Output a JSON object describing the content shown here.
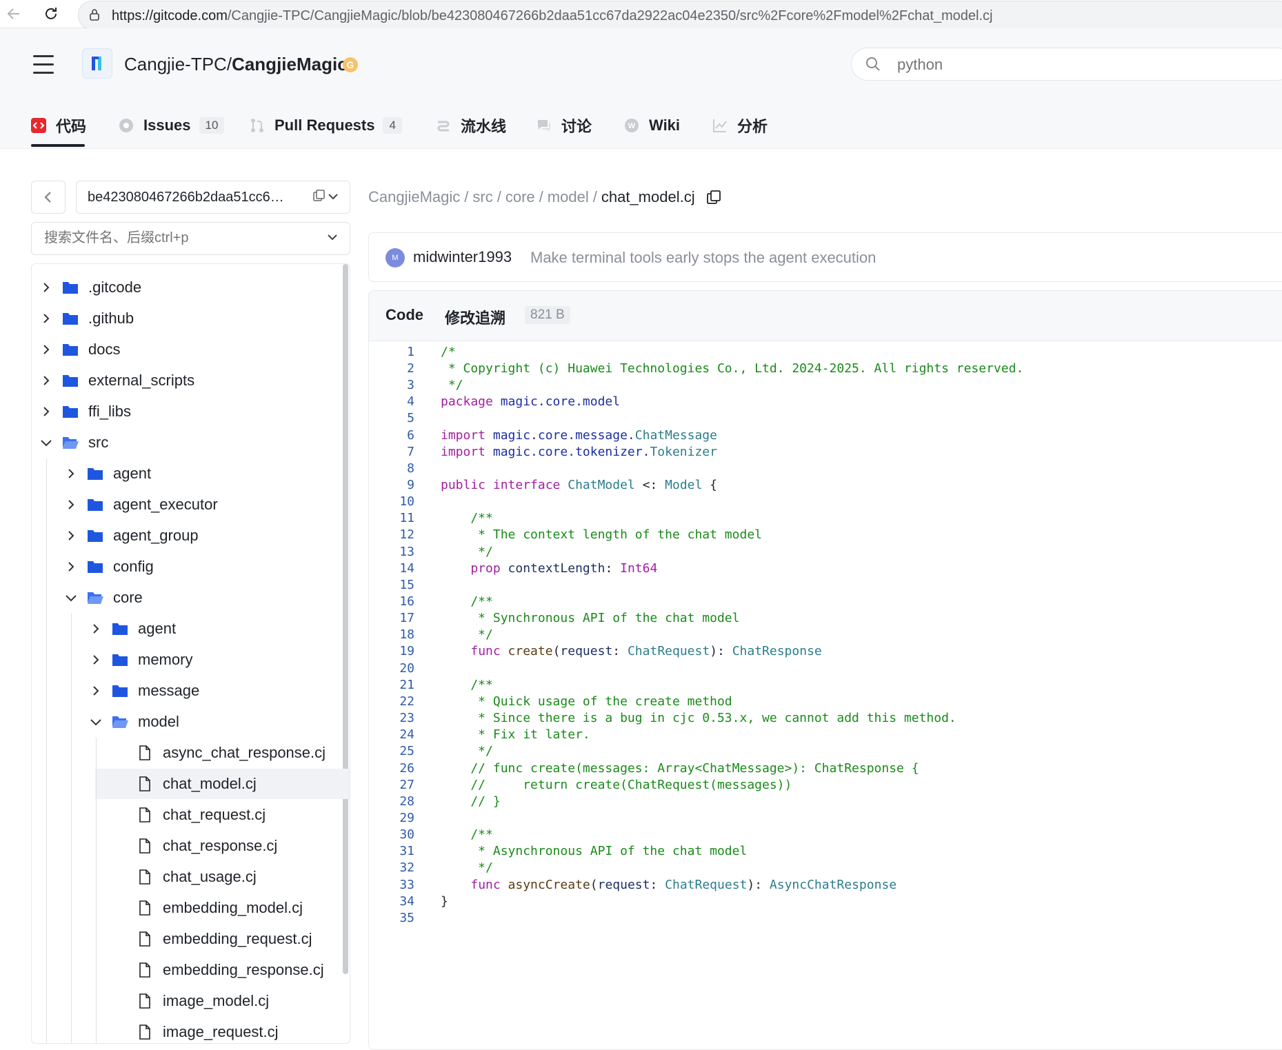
{
  "browser": {
    "url_host": "https://gitcode.com",
    "url_path": "/Cangjie-TPC/CangjieMagic/blob/be423080467266b2daa51cc67da2922ac04e2350/src%2Fcore%2Fmodel%2Fchat_model.cj"
  },
  "header": {
    "owner": "Cangjie-TPC/",
    "repo": "CangjieMagic",
    "badge": "G",
    "search_placeholder": "python"
  },
  "tabs": [
    {
      "label": "代码"
    },
    {
      "label": "Issues",
      "count": "10"
    },
    {
      "label": "Pull Requests",
      "count": "4"
    },
    {
      "label": "流水线"
    },
    {
      "label": "讨论"
    },
    {
      "label": "Wiki"
    },
    {
      "label": "分析"
    }
  ],
  "sidebar": {
    "branch": "be423080467266b2daa51cc6…",
    "file_search_placeholder": "搜索文件名、后缀ctrl+p",
    "tree": [
      {
        "name": ".gitcode",
        "type": "folder",
        "depth": 0,
        "expanded": false
      },
      {
        "name": ".github",
        "type": "folder",
        "depth": 0,
        "expanded": false
      },
      {
        "name": "docs",
        "type": "folder",
        "depth": 0,
        "expanded": false
      },
      {
        "name": "external_scripts",
        "type": "folder",
        "depth": 0,
        "expanded": false
      },
      {
        "name": "ffi_libs",
        "type": "folder",
        "depth": 0,
        "expanded": false
      },
      {
        "name": "src",
        "type": "folder",
        "depth": 0,
        "expanded": true
      },
      {
        "name": "agent",
        "type": "folder",
        "depth": 1,
        "expanded": false
      },
      {
        "name": "agent_executor",
        "type": "folder",
        "depth": 1,
        "expanded": false
      },
      {
        "name": "agent_group",
        "type": "folder",
        "depth": 1,
        "expanded": false
      },
      {
        "name": "config",
        "type": "folder",
        "depth": 1,
        "expanded": false
      },
      {
        "name": "core",
        "type": "folder",
        "depth": 1,
        "expanded": true
      },
      {
        "name": "agent",
        "type": "folder",
        "depth": 2,
        "expanded": false
      },
      {
        "name": "memory",
        "type": "folder",
        "depth": 2,
        "expanded": false
      },
      {
        "name": "message",
        "type": "folder",
        "depth": 2,
        "expanded": false
      },
      {
        "name": "model",
        "type": "folder",
        "depth": 2,
        "expanded": true
      },
      {
        "name": "async_chat_response.cj",
        "type": "file",
        "depth": 3
      },
      {
        "name": "chat_model.cj",
        "type": "file",
        "depth": 3,
        "selected": true
      },
      {
        "name": "chat_request.cj",
        "type": "file",
        "depth": 3
      },
      {
        "name": "chat_response.cj",
        "type": "file",
        "depth": 3
      },
      {
        "name": "chat_usage.cj",
        "type": "file",
        "depth": 3
      },
      {
        "name": "embedding_model.cj",
        "type": "file",
        "depth": 3
      },
      {
        "name": "embedding_request.cj",
        "type": "file",
        "depth": 3
      },
      {
        "name": "embedding_response.cj",
        "type": "file",
        "depth": 3
      },
      {
        "name": "image_model.cj",
        "type": "file",
        "depth": 3
      },
      {
        "name": "image_request.cj",
        "type": "file",
        "depth": 3
      }
    ]
  },
  "breadcrumb": [
    "CangjieMagic",
    "src",
    "core",
    "model",
    "chat_model.cj"
  ],
  "commit": {
    "avatar": "M",
    "author": "midwinter1993",
    "message": "Make terminal tools early stops the agent execution"
  },
  "code_panel": {
    "tab_code": "Code",
    "tab_blame": "修改追溯",
    "size": "821 B"
  },
  "colors": {
    "comment": "#1a8a1a",
    "keyword": "#a020a0",
    "type": "#2c7c8c",
    "folder": "#1f56e0",
    "accent_red": "#e4292f"
  },
  "code": [
    [
      [
        "c",
        "/*"
      ]
    ],
    [
      [
        "c",
        " * Copyright (c) Huawei Technologies Co., Ltd. 2024-2025. All rights reserved."
      ]
    ],
    [
      [
        "c",
        " */"
      ]
    ],
    [
      [
        "k",
        "package "
      ],
      [
        "n",
        "magic.core.model"
      ]
    ],
    [],
    [
      [
        "k",
        "import "
      ],
      [
        "n",
        "magic.core.message."
      ],
      [
        "t",
        "ChatMessage"
      ]
    ],
    [
      [
        "k",
        "import "
      ],
      [
        "n",
        "magic.core.tokenizer."
      ],
      [
        "t",
        "Tokenizer"
      ]
    ],
    [],
    [
      [
        "k",
        "public interface "
      ],
      [
        "t",
        "ChatModel"
      ],
      [
        "p",
        " <: "
      ],
      [
        "t",
        "Model"
      ],
      [
        "p",
        " {"
      ]
    ],
    [],
    [
      [
        "c",
        "    /**"
      ]
    ],
    [
      [
        "c",
        "     * The context length of the chat model"
      ]
    ],
    [
      [
        "c",
        "     */"
      ]
    ],
    [
      [
        "p",
        "    "
      ],
      [
        "k",
        "prop "
      ],
      [
        "a",
        "contextLength"
      ],
      [
        "p",
        ": "
      ],
      [
        "k",
        "Int64"
      ]
    ],
    [],
    [
      [
        "c",
        "    /**"
      ]
    ],
    [
      [
        "c",
        "     * Synchronous API of the chat model"
      ]
    ],
    [
      [
        "c",
        "     */"
      ]
    ],
    [
      [
        "p",
        "    "
      ],
      [
        "k",
        "func "
      ],
      [
        "f",
        "create"
      ],
      [
        "p",
        "("
      ],
      [
        "a",
        "request"
      ],
      [
        "p",
        ": "
      ],
      [
        "t",
        "ChatRequest"
      ],
      [
        "p",
        "): "
      ],
      [
        "t",
        "ChatResponse"
      ]
    ],
    [],
    [
      [
        "c",
        "    /**"
      ]
    ],
    [
      [
        "c",
        "     * Quick usage of the create method"
      ]
    ],
    [
      [
        "c",
        "     * Since there is a bug in cjc 0.53.x, we cannot add this method."
      ]
    ],
    [
      [
        "c",
        "     * Fix it later."
      ]
    ],
    [
      [
        "c",
        "     */"
      ]
    ],
    [
      [
        "c",
        "    // func create(messages: Array<ChatMessage>): ChatResponse {"
      ]
    ],
    [
      [
        "c",
        "    //     return create(ChatRequest(messages))"
      ]
    ],
    [
      [
        "c",
        "    // }"
      ]
    ],
    [],
    [
      [
        "c",
        "    /**"
      ]
    ],
    [
      [
        "c",
        "     * Asynchronous API of the chat model"
      ]
    ],
    [
      [
        "c",
        "     */"
      ]
    ],
    [
      [
        "p",
        "    "
      ],
      [
        "k",
        "func "
      ],
      [
        "f",
        "asyncCreate"
      ],
      [
        "p",
        "("
      ],
      [
        "a",
        "request"
      ],
      [
        "p",
        ": "
      ],
      [
        "t",
        "ChatRequest"
      ],
      [
        "p",
        "): "
      ],
      [
        "t",
        "AsyncChatResponse"
      ]
    ],
    [
      [
        "p",
        "}"
      ]
    ],
    []
  ]
}
